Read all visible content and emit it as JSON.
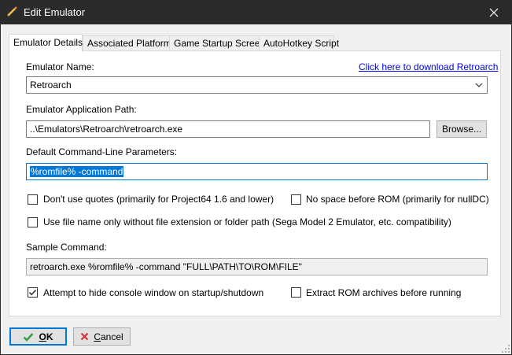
{
  "window": {
    "title": "Edit Emulator",
    "app_icon": "pencil-icon",
    "close_icon": "close-icon"
  },
  "tabs": [
    {
      "label": "Emulator Details",
      "active": true
    },
    {
      "label": "Associated Platforms",
      "active": false
    },
    {
      "label": "Game Startup Screen",
      "active": false
    },
    {
      "label": "AutoHotkey Script",
      "active": false
    }
  ],
  "form": {
    "emulator_name_label": "Emulator Name:",
    "download_link": "Click here to download Retroarch",
    "emulator_name_value": "Retroarch",
    "app_path_label": "Emulator Application Path:",
    "app_path_value": "..\\Emulators\\Retroarch\\retroarch.exe",
    "browse_label": "Browse...",
    "cmdline_label": "Default Command-Line Parameters:",
    "cmdline_value": "%romfile% -command",
    "options": [
      {
        "label": "Don't use quotes (primarily for Project64 1.6 and lower)",
        "checked": false
      },
      {
        "label": "No space before ROM (primarily for nullDC)",
        "checked": false
      },
      {
        "label": "Use file name only without file extension or folder path (Sega Model 2 Emulator, etc. compatibility)",
        "checked": false
      }
    ],
    "sample_label": "Sample Command:",
    "sample_value": "retroarch.exe %romfile% -command \"FULL\\PATH\\TO\\ROM\\FILE\"",
    "bottom_options": [
      {
        "label": "Attempt to hide console window on startup/shutdown",
        "checked": true
      },
      {
        "label": "Extract ROM archives before running",
        "checked": false
      }
    ]
  },
  "footer": {
    "ok_underline": "O",
    "ok_rest": "K",
    "cancel_underline": "C",
    "cancel_rest": "ancel",
    "ok_icon": "checkmark-icon",
    "cancel_icon": "x-icon",
    "ok_icon_color": "#2e9e3a",
    "cancel_icon_color": "#d13438"
  }
}
